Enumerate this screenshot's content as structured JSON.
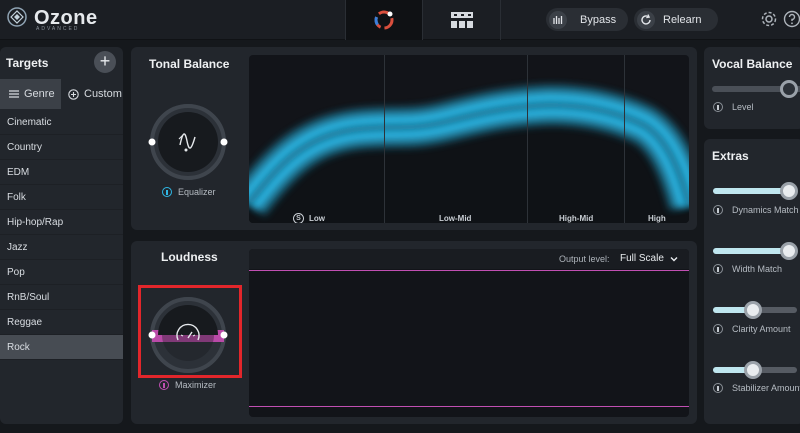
{
  "header": {
    "app_name": "Ozone",
    "app_edition": "ADVANCED",
    "bypass_label": "Bypass",
    "relearn_label": "Relearn",
    "icons": [
      "ozone-logo-icon",
      "assistant-icon",
      "grid-view-icon",
      "bypass-icon",
      "relearn-icon",
      "settings-icon",
      "help-icon"
    ]
  },
  "targets": {
    "title": "Targets",
    "add_icon": "+",
    "tabs": [
      {
        "label": "Genre",
        "icon": "list-icon",
        "active": true
      },
      {
        "label": "Custom",
        "icon": "add-circle-icon",
        "active": false
      }
    ],
    "genres": [
      {
        "label": "Cinematic"
      },
      {
        "label": "Country"
      },
      {
        "label": "EDM"
      },
      {
        "label": "Folk"
      },
      {
        "label": "Hip-hop/Rap"
      },
      {
        "label": "Jazz"
      },
      {
        "label": "Pop"
      },
      {
        "label": "RnB/Soul"
      },
      {
        "label": "Reggae"
      },
      {
        "label": "Rock"
      }
    ],
    "selected_genre": "Rock"
  },
  "tonal_balance": {
    "title": "Tonal Balance",
    "module_label": "Equalizer",
    "bands": [
      {
        "label": "Low",
        "badge": "S"
      },
      {
        "label": "Low-Mid"
      },
      {
        "label": "High-Mid"
      },
      {
        "label": "High"
      }
    ]
  },
  "loudness": {
    "title": "Loudness",
    "module_label": "Maximizer",
    "output_level_label": "Output level:",
    "output_level_value": "Full Scale"
  },
  "vocal_balance": {
    "title": "Vocal Balance",
    "level_label": "Level"
  },
  "extras": {
    "title": "Extras",
    "sliders": [
      {
        "label": "Dynamics Match",
        "value": 0.9
      },
      {
        "label": "Width Match",
        "value": 0.9
      },
      {
        "label": "Clarity Amount",
        "value": 0.48
      },
      {
        "label": "Stabilizer Amount",
        "value": 0.48
      }
    ]
  },
  "colors": {
    "accent_blue": "#2fb8e6",
    "accent_pink": "#c04fb2",
    "highlight": "#e2262b"
  }
}
